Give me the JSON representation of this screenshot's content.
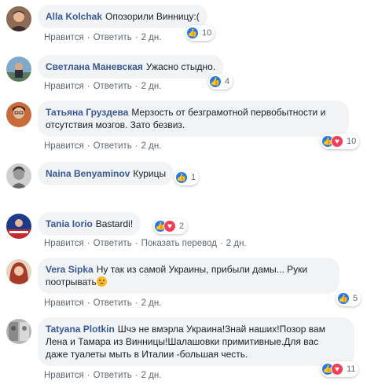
{
  "actions": {
    "like": "Нравится",
    "reply": "Ответить",
    "translate": "Показать перевод"
  },
  "comments": [
    {
      "author": "Alla Kolchak",
      "text": "Опозорили Винницу:(",
      "time": "2 дн.",
      "reactions_count": "10"
    },
    {
      "author": "Светлана Маневская",
      "text": "Ужасно стыдно.",
      "time": "2 дн.",
      "reactions_count": "4"
    },
    {
      "author": "Татьяна Груздева",
      "text_line1": "Мерзость от безграмотной первобытности и",
      "text_line2": "отсутствия мозгов. Зато безвиз.",
      "time": "2 дн.",
      "reactions_count": "10"
    },
    {
      "author": "Naina Benyaminov",
      "text": "Курицы",
      "reactions_count": "1"
    },
    {
      "author": "Tania Iorio",
      "text": "Bastardi!",
      "time": "2 дн.",
      "reactions_count": "2"
    },
    {
      "author": "Vera Sipka",
      "text_line1": "Ну так из самой Украины, прибыли дамы... Руки",
      "text_line2": "поотрывать",
      "time": "2 дн.",
      "reactions_count": "5"
    },
    {
      "author": "Tatyana Plotkin",
      "text_line1": "Шчэ не вмэрла Украина!Знай наших!Позор вам",
      "text_line2": "Лена и Тамара из Винницы!Шалашовки примитивные.Для вас",
      "text_line3": "даже туалеты мыть в Италии -большая честь.",
      "time": "2 дн.",
      "reactions_count": "11"
    }
  ],
  "colors": {
    "link": "#385898",
    "bubble": "#f2f3f5",
    "like": "#2078f4",
    "love": "#f33e58"
  }
}
